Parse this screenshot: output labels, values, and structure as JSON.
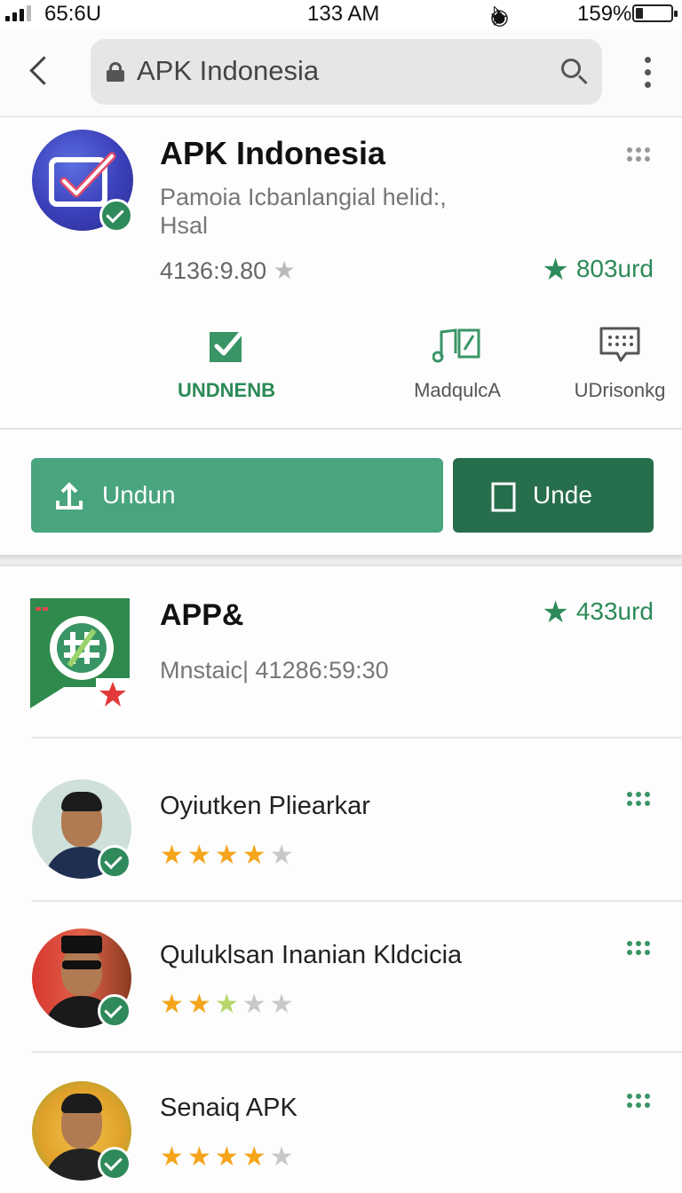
{
  "status_bar": {
    "carrier_time": "65:6U",
    "clock": "133 AM",
    "battery_text": "159%",
    "battery_level": 0.2
  },
  "topbar": {
    "search_text": "APK Indonesia"
  },
  "app": {
    "title": "APK Indonesia",
    "subtitle": "Pamoia Icbanlangial helid:, Hsal",
    "rating_text": "4136:9.80",
    "count": "803urd",
    "actions": [
      {
        "label": "UNDNENB",
        "icon": "download-check-icon"
      },
      {
        "label": "MadqulcA",
        "icon": "music-icon"
      },
      {
        "label": "UDrisonkg",
        "icon": "chat-icon"
      }
    ],
    "primary_button": "Undun",
    "secondary_button": "Unde"
  },
  "second_app": {
    "title": "APP&",
    "meta": "Mnstaic| 41286:59:30",
    "count": "433urd"
  },
  "reviews": [
    {
      "name": "Oyiutken Pliearkar",
      "rating": 4
    },
    {
      "name": "Quluklsan Inanian Kldcicia",
      "rating": 2.5
    },
    {
      "name": "Senaiq APK",
      "rating": 4
    }
  ],
  "colors": {
    "accent_green": "#2c8a57",
    "button_primary": "#48a57d",
    "button_secondary": "#276e4c",
    "star": "#f4a51c"
  }
}
